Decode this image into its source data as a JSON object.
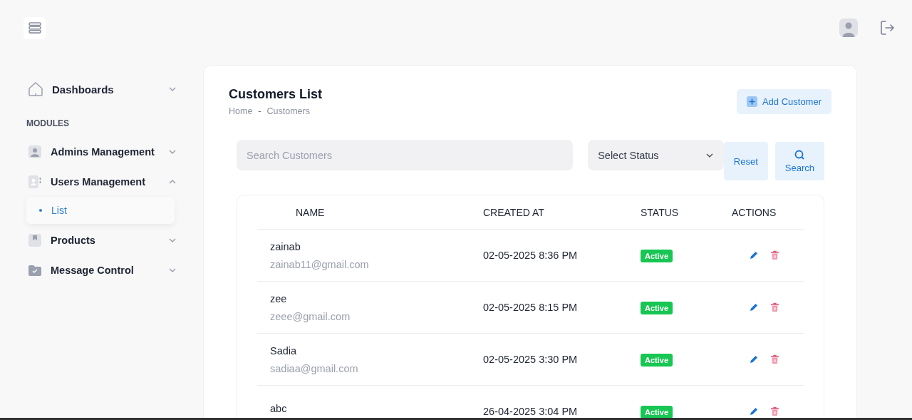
{
  "sidebar": {
    "top_items": [
      {
        "label": "Dashboards",
        "kind": "home",
        "expanded": false
      }
    ],
    "section_title": "MODULES",
    "items": [
      {
        "label": "Admins Management",
        "kind": "person",
        "expanded": false
      },
      {
        "label": "Users Management",
        "kind": "contact",
        "expanded": true,
        "children": [
          {
            "label": "List",
            "selected": true
          }
        ]
      },
      {
        "label": "Products",
        "kind": "bookmark",
        "expanded": false
      },
      {
        "label": "Message Control",
        "kind": "folder",
        "expanded": false
      }
    ]
  },
  "page": {
    "title": "Customers List",
    "breadcrumb": [
      {
        "kind": "link",
        "label": "Home"
      },
      {
        "kind": "separator",
        "label": "-"
      },
      {
        "kind": "link",
        "label": "Customers"
      }
    ],
    "add_button": "Add Customer"
  },
  "filters": {
    "search": {
      "placeholder": "Search Customers"
    },
    "status_select": "Select Status",
    "reset_button": "Reset",
    "search_button": "Search"
  },
  "table": {
    "columns": [
      "NAME",
      "CREATED AT",
      "STATUS",
      "ACTIONS"
    ],
    "rows": [
      {
        "name": "zainab",
        "email": "zainab11@gmail.com",
        "created_at": "02-05-2025 8:36 PM",
        "status": "Active"
      },
      {
        "name": "zee",
        "email": "zeee@gmail.com",
        "created_at": "02-05-2025 8:15 PM",
        "status": "Active"
      },
      {
        "name": "Sadia",
        "email": "sadiaa@gmail.com",
        "created_at": "02-05-2025 3:30 PM",
        "status": "Active"
      },
      {
        "name": "abc",
        "created_at": "26-04-2025 3:04 PM",
        "status": "Active"
      }
    ]
  }
}
